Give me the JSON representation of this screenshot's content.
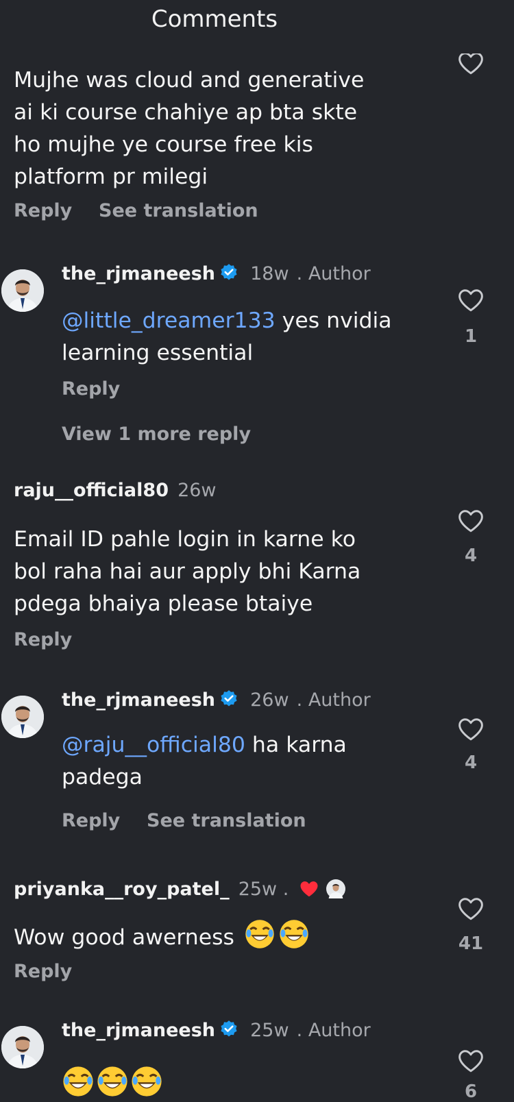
{
  "header": {
    "title": "Comments"
  },
  "comments": [
    {
      "text_lines": [
        "Mujhe was cloud and generative",
        "ai ki course chahiye ap bta skte",
        "ho mujhe ye course free kis",
        "platform pr milegi"
      ],
      "reply_label": "Reply",
      "translate_label": "See translation"
    },
    {
      "username": "the_rjmaneesh",
      "time": "18w",
      "author_tag": ". Author",
      "mention": "@little_dreamer133",
      "text_line1": " yes nvidia",
      "text_line2": "learning essential",
      "reply_label": "Reply",
      "view_more": "View 1 more reply",
      "likes": "1"
    },
    {
      "username": "raju__official80",
      "time": "26w",
      "text_lines": [
        "Email ID pahle login in karne ko",
        "bol raha hai aur apply bhi Karna",
        "pdega bhaiya please btaiye"
      ],
      "reply_label": "Reply",
      "likes": "4"
    },
    {
      "username": "the_rjmaneesh",
      "time": "26w",
      "author_tag": ". Author",
      "mention": "@raju__official80",
      "text_line1": " ha karna",
      "text_line2": "padega",
      "reply_label": "Reply",
      "translate_label": "See translation",
      "likes": "4"
    },
    {
      "username": "priyanka__roy_patel_",
      "time": "25w .",
      "text": "Wow good awerness",
      "reply_label": "Reply",
      "likes": "41"
    },
    {
      "username": "the_rjmaneesh",
      "time": "25w",
      "author_tag": ". Author",
      "likes": "6"
    }
  ],
  "colors": {
    "background": "#24262b",
    "text": "#f5f5f5",
    "secondary": "#a6a8ad",
    "mention": "#6ea8ff",
    "verified": "#1d9bf0",
    "heart_red": "#ff2d3c"
  },
  "icons": [
    "heart-icon",
    "verified-badge-icon",
    "laughing-emoji-icon",
    "red-heart-icon"
  ]
}
